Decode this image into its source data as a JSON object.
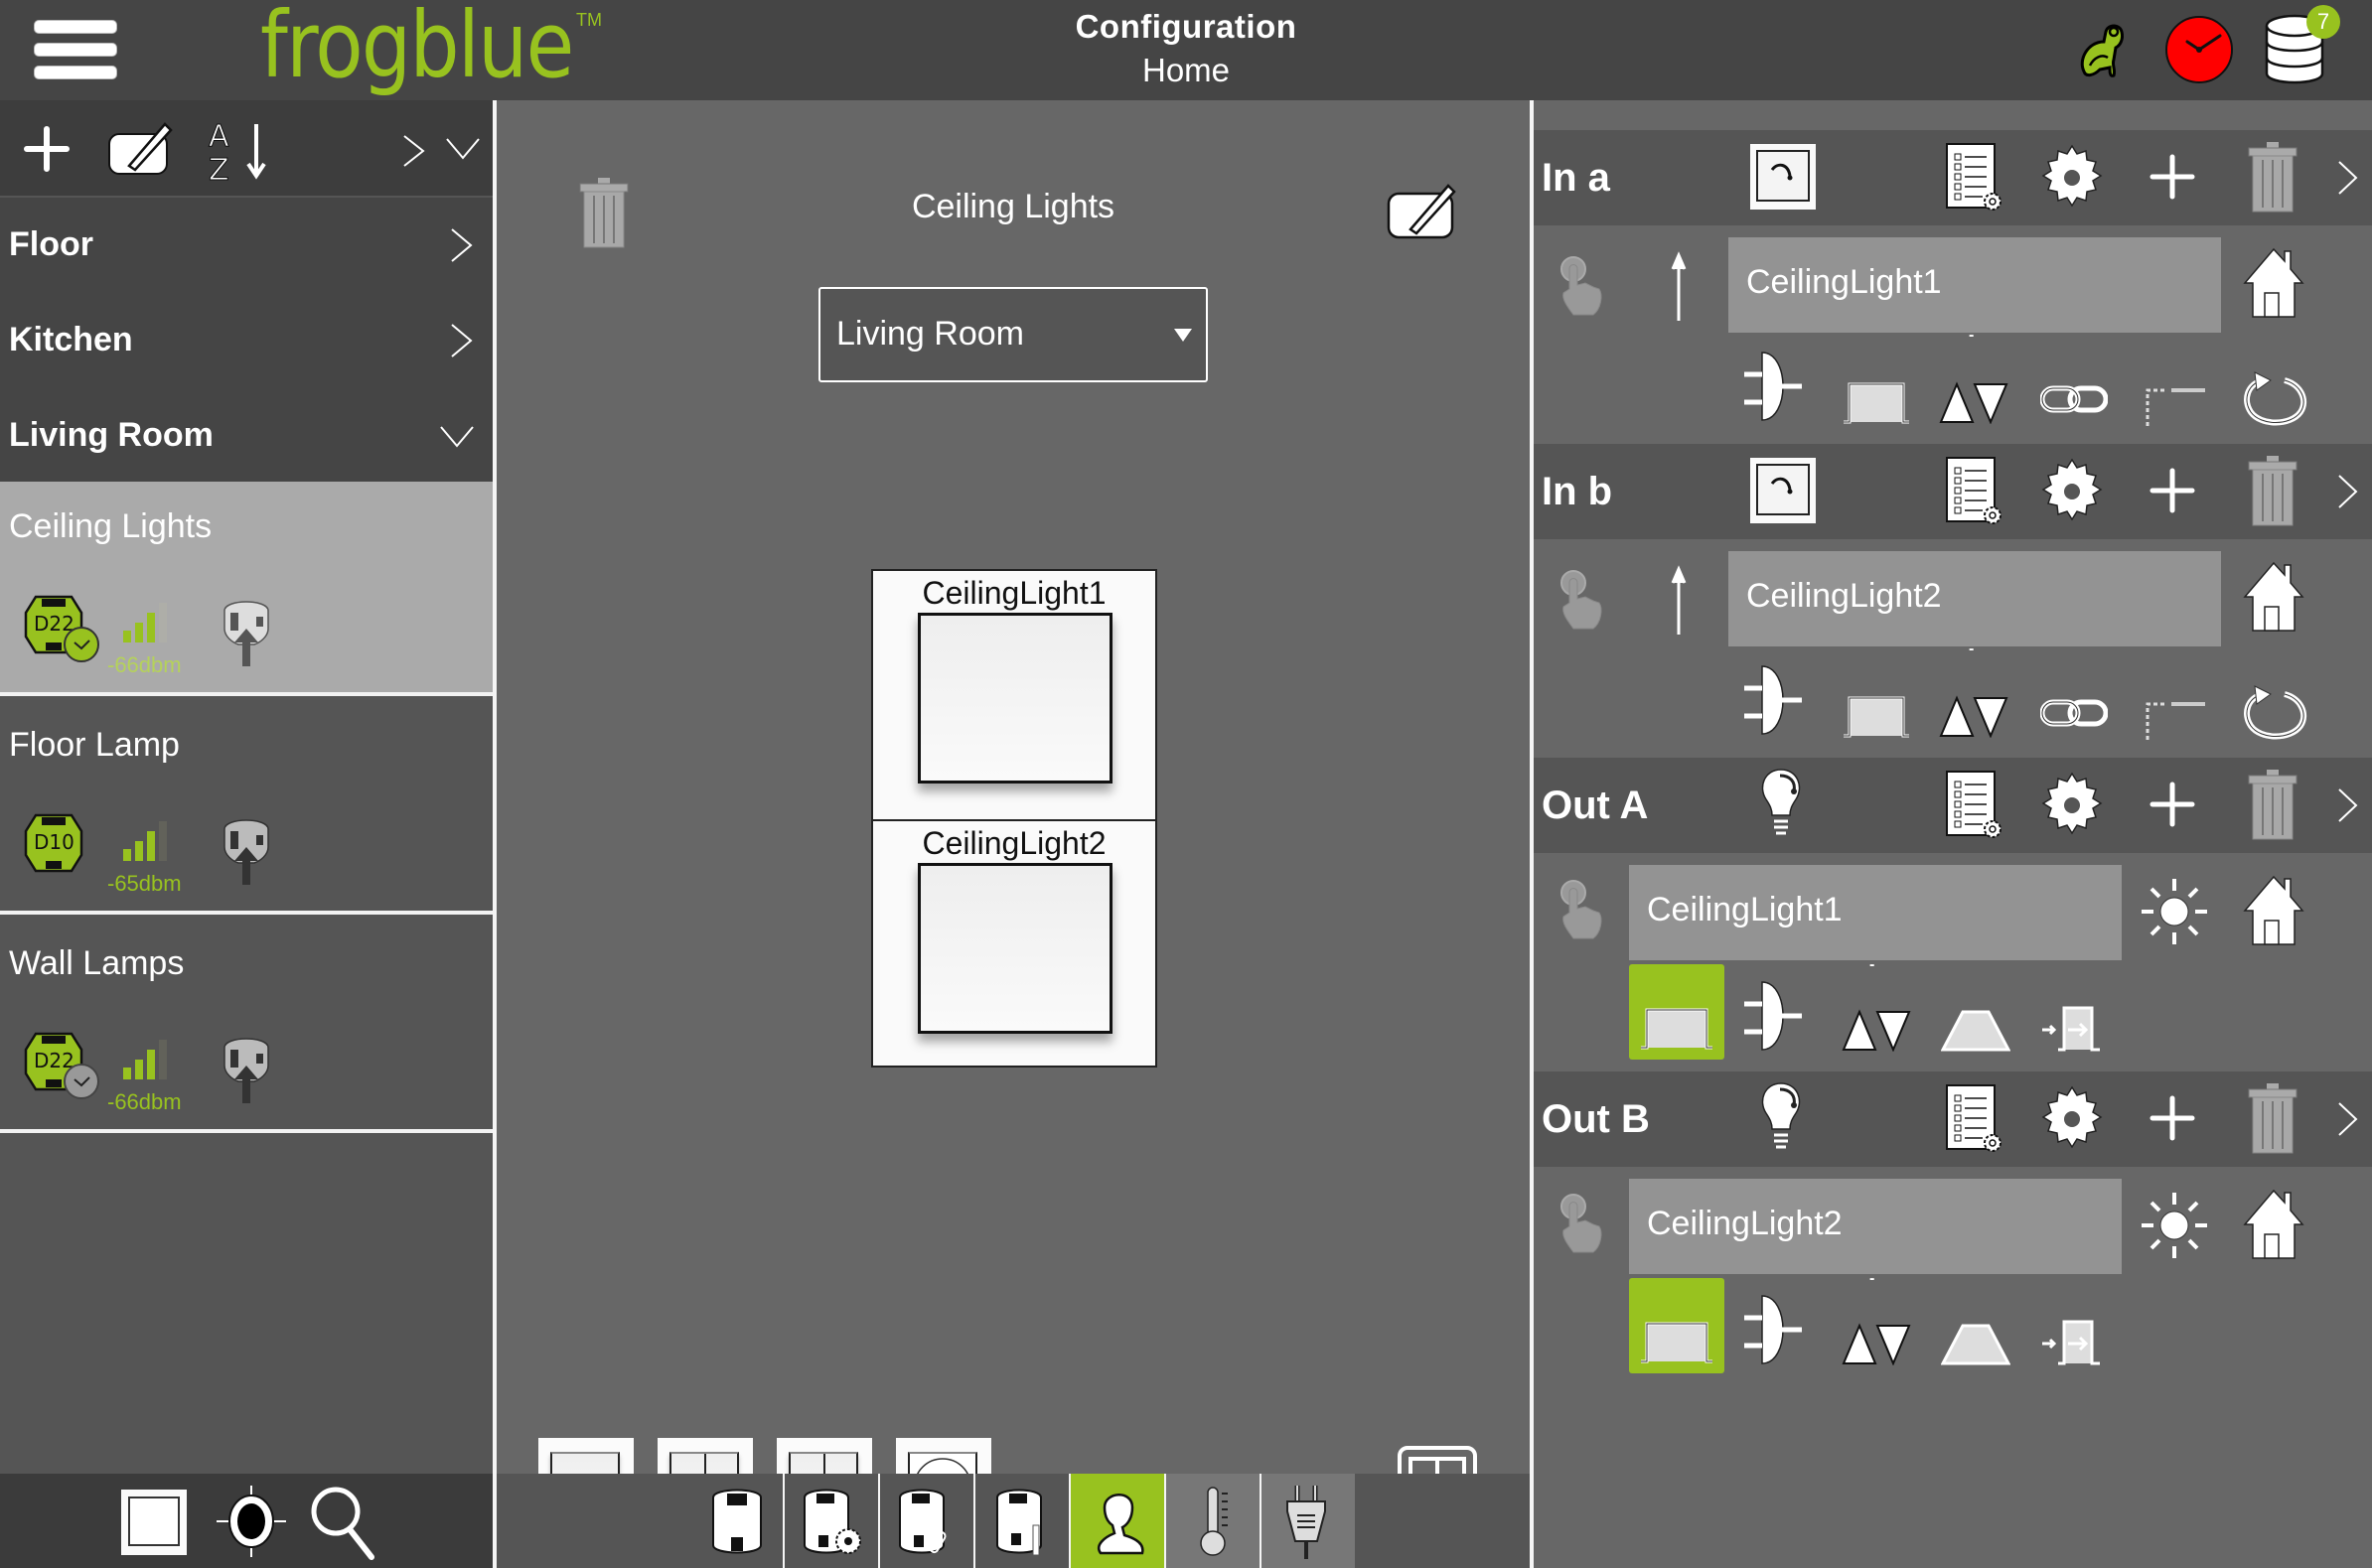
{
  "header": {
    "logo": "frogblue",
    "logo_tm": "TM",
    "title": "Configuration",
    "subtitle": "Home",
    "icons": [
      "menu-icon",
      "frog-icon",
      "clock-icon",
      "database-icon"
    ],
    "database_badge": "7",
    "colors": {
      "brand_green": "#98c21f",
      "clock_red": "#ff0000"
    }
  },
  "left_panel": {
    "toolbar": {
      "icons": [
        "add-icon",
        "edit-icon",
        "sort-az-icon",
        "expand-right-icon",
        "expand-down-icon"
      ]
    },
    "rooms": [
      {
        "label": "Floor",
        "expanded": false
      },
      {
        "label": "Kitchen",
        "expanded": false
      },
      {
        "label": "Living Room",
        "expanded": true
      }
    ],
    "devices": [
      {
        "name": "Ceiling Lights",
        "chip": "D22",
        "timer": true,
        "timer_active": true,
        "signal": "-66dbm",
        "signal_bars": 3,
        "selected": true
      },
      {
        "name": "Floor Lamp",
        "chip": "D10",
        "timer": false,
        "timer_active": false,
        "signal": "-65dbm",
        "signal_bars": 3,
        "selected": false
      },
      {
        "name": "Wall Lamps",
        "chip": "D22",
        "timer": true,
        "timer_active": false,
        "signal": "-66dbm",
        "signal_bars": 3,
        "selected": false
      }
    ],
    "bottom_icons": [
      "switch-view-icon",
      "locate-icon",
      "search-icon"
    ]
  },
  "middle_panel": {
    "title": "Ceiling Lights",
    "room_select": {
      "value": "Living Room"
    },
    "switch_buttons": [
      "CeilingLight1",
      "CeilingLight2"
    ],
    "templates": [
      "single-rocker",
      "double-rocker",
      "up-down-rocker",
      "socket"
    ],
    "tabs": [
      {
        "icon": "device-icon",
        "active": false
      },
      {
        "icon": "device-settings-icon",
        "active": false
      },
      {
        "icon": "device-link-icon",
        "active": false
      },
      {
        "icon": "device-info-icon",
        "active": false
      },
      {
        "icon": "user-icon",
        "active": true
      },
      {
        "icon": "thermometer-icon",
        "active": false
      },
      {
        "icon": "plug-icon",
        "active": false
      }
    ]
  },
  "right_panel": {
    "inputs": [
      {
        "title": "In a",
        "name": "CeilingLight1"
      },
      {
        "title": "In b",
        "name": "CeilingLight2"
      }
    ],
    "outputs": [
      {
        "title": "Out A",
        "name": "CeilingLight1"
      },
      {
        "title": "Out B",
        "name": "CeilingLight2"
      }
    ],
    "minus_label": "-"
  }
}
